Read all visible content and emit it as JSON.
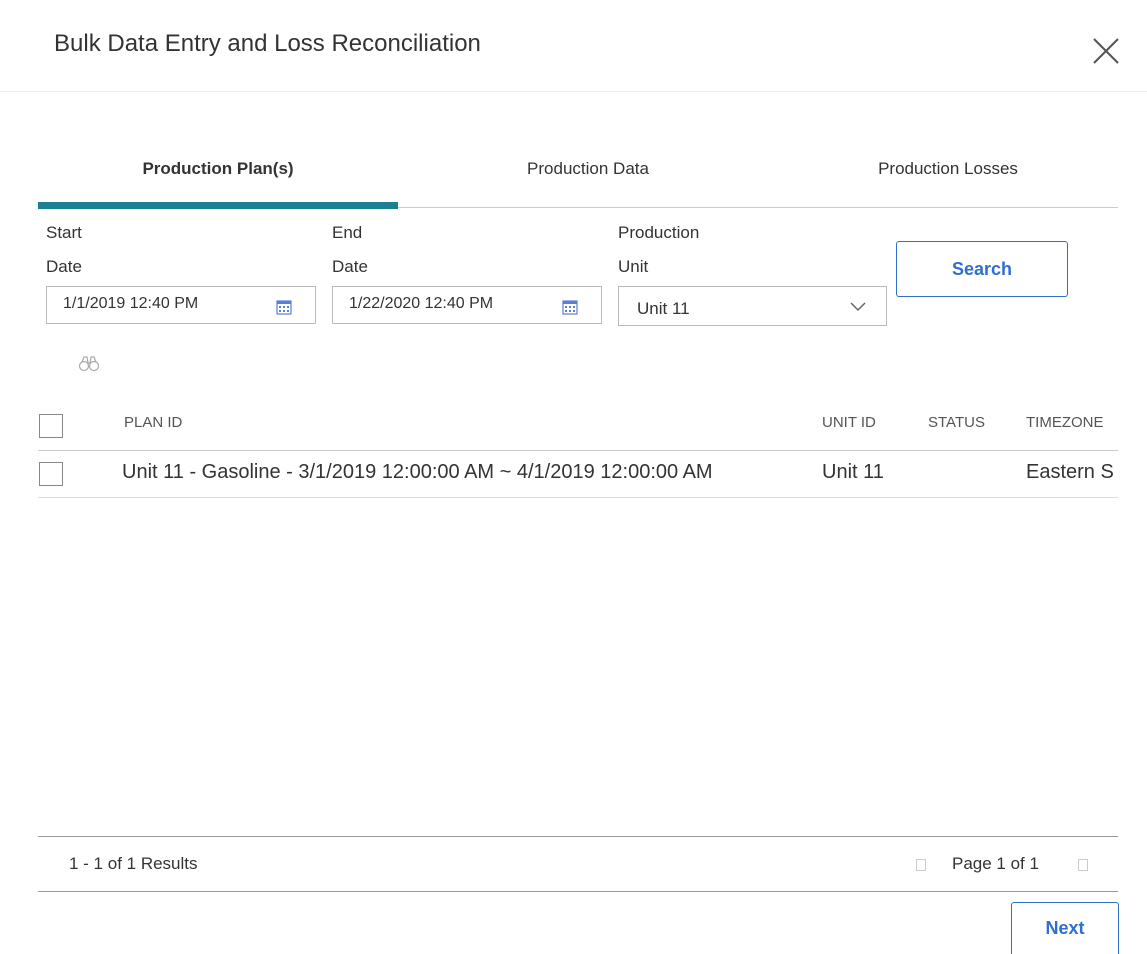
{
  "dialog": {
    "title": "Bulk Data Entry and Loss Reconciliation"
  },
  "tabs": [
    {
      "label": "Production Plan(s)",
      "active": true
    },
    {
      "label": "Production Data",
      "active": false
    },
    {
      "label": "Production Losses",
      "active": false
    }
  ],
  "filters": {
    "start": {
      "label_line1": "Start",
      "label_line2": "Date",
      "value": "1/1/2019 12:40 PM"
    },
    "end": {
      "label_line1": "End",
      "label_line2": "Date",
      "value": "1/22/2020 12:40 PM"
    },
    "unit": {
      "label_line1": "Production",
      "label_line2": "Unit",
      "value": "Unit 11"
    },
    "search_label": "Search"
  },
  "grid": {
    "columns": [
      "PLAN ID",
      "UNIT ID",
      "STATUS",
      "TIMEZONE"
    ],
    "rows": [
      {
        "plan_id": "Unit 11 - Gasoline - 3/1/2019 12:00:00 AM ~ 4/1/2019 12:00:00 AM",
        "unit_id": "Unit 11",
        "status": "",
        "timezone": "Eastern S"
      }
    ]
  },
  "footer": {
    "results": "1 - 1 of 1 Results",
    "page": "Page 1 of 1"
  },
  "next_label": "Next",
  "colors": {
    "accent": "#1a8092",
    "primary": "#2e6fd0",
    "calendar": "#5b7fd3"
  }
}
